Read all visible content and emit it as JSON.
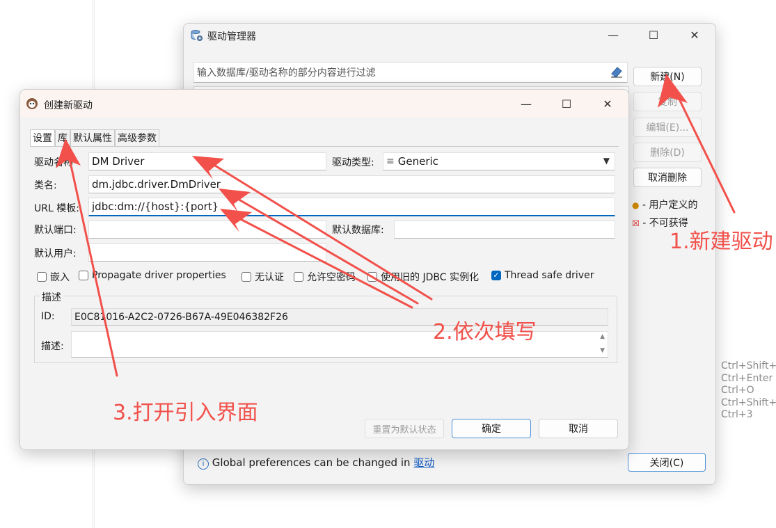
{
  "background_app": {
    "shortcuts": [
      "Ctrl+Shift+",
      "Ctrl+Enter",
      "Ctrl+O",
      "Ctrl+Shift+",
      "Ctrl+3"
    ]
  },
  "driver_manager": {
    "title": "驱动管理器",
    "filter_placeholder": "输入数据库/驱动名称的部分内容进行过滤",
    "buttons": {
      "new": "新建(N)",
      "copy": "复制",
      "edit": "编辑(E)...",
      "delete": "删除(D)",
      "cancel_delete": "取消删除",
      "close": "关闭(C)"
    },
    "legend": {
      "user_defined": "- 用户定义的",
      "unavailable": "- 不可获得"
    },
    "footer": {
      "text": "Global preferences can be changed in ",
      "link": "驱动"
    }
  },
  "create_driver": {
    "title": "创建新驱动",
    "tabs": [
      "设置",
      "库",
      "默认属性",
      "高级参数"
    ],
    "fields": {
      "driver_name_label": "驱动名称",
      "driver_name_value": "DM Driver",
      "driver_type_label": "驱动类型:",
      "driver_type_value": "Generic",
      "class_name_label": "类名:",
      "class_name_value": "dm.jdbc.driver.DmDriver",
      "url_template_label": "URL 模板:",
      "url_template_value": "jdbc:dm://{host}:{port}",
      "default_port_label": "默认端口:",
      "default_port_value": "",
      "default_db_label": "默认数据库:",
      "default_db_value": "",
      "default_user_label": "默认用户:",
      "default_user_value": ""
    },
    "checkboxes": [
      {
        "label": "嵌入",
        "checked": false
      },
      {
        "label": "Propagate driver properties",
        "checked": false
      },
      {
        "label": "无认证",
        "checked": false
      },
      {
        "label": "允许空密码",
        "checked": false
      },
      {
        "label": "使用旧的 JDBC 实例化",
        "checked": false
      },
      {
        "label": "Thread safe driver",
        "checked": true
      }
    ],
    "description_group": {
      "title": "描述",
      "id_label": "ID:",
      "id_value": "E0C81016-A2C2-0726-B67A-49E046382F26",
      "desc_label": "描述:"
    },
    "buttons": {
      "reset": "重置为默认状态",
      "ok": "确定",
      "cancel": "取消"
    }
  },
  "annotations": {
    "step1": "1.新建驱动",
    "step2": "2.依次填写",
    "step3": "3.打开引入界面",
    "color": "#f2504a"
  }
}
